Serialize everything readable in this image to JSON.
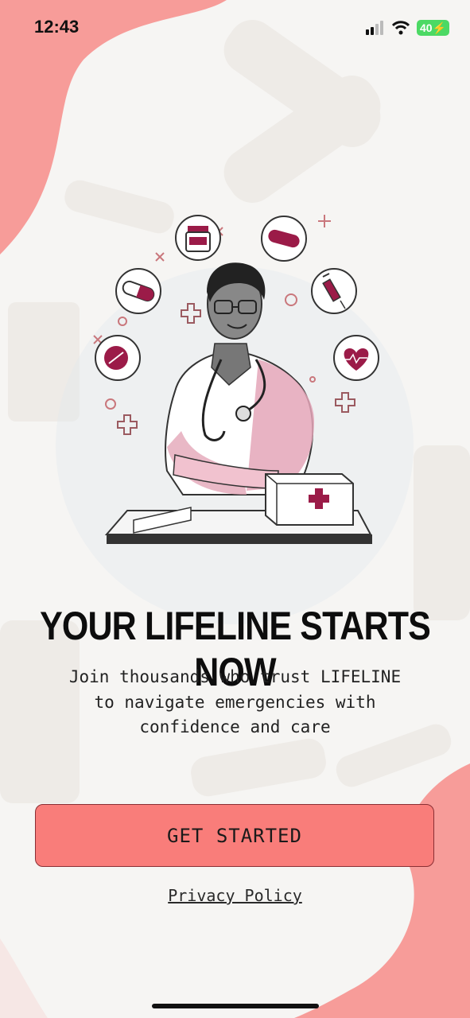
{
  "status_bar": {
    "time": "12:43",
    "battery": "40"
  },
  "onboarding": {
    "headline": "YOUR LIFELINE STARTS NOW",
    "subtext": "Join thousands who trust LIFELINE\nto navigate emergencies with\nconfidence and care",
    "cta_label": "GET STARTED",
    "privacy_label": "Privacy Policy"
  },
  "colors": {
    "blob": "#f79c99",
    "button": "#f97d7a",
    "button_border": "#8a2f34",
    "accent": "#9b1b48",
    "background": "#f6f5f3"
  },
  "icons": [
    "pill-bottle-icon",
    "bandage-icon",
    "capsule-icon",
    "syringe-icon",
    "tablet-icon",
    "heart-pulse-icon",
    "first-aid-kit-icon"
  ]
}
